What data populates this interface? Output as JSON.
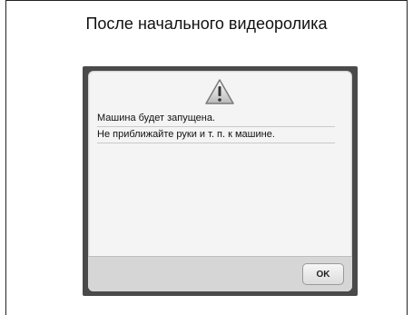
{
  "caption": "После начального видеоролика",
  "dialog": {
    "icon": "warning-icon",
    "message_line_1": "Машина будет запущена.",
    "message_line_2": "Не приближайте руки и т. п. к машине.",
    "ok_label": "OK"
  }
}
